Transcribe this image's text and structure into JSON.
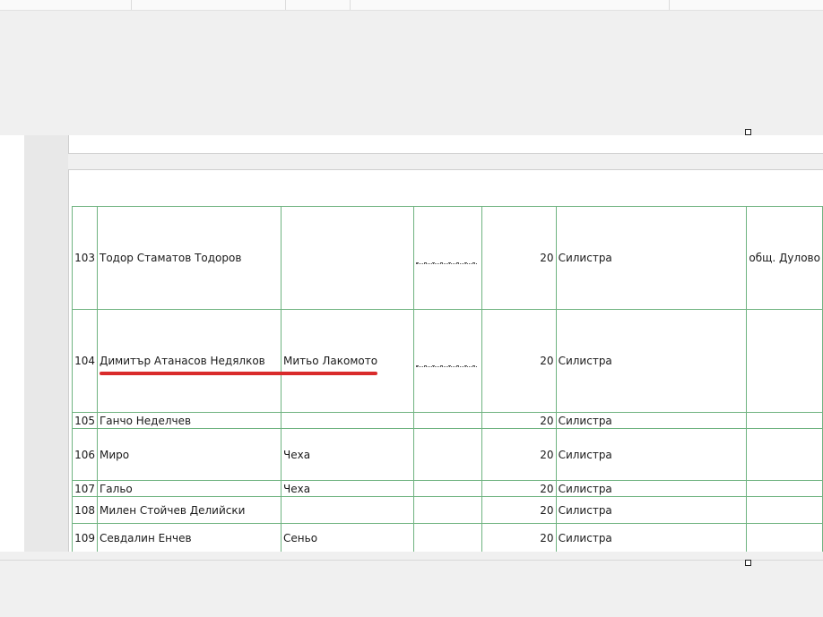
{
  "rows": [
    {
      "no": "103",
      "name": "Тодор Стаматов Тодоров",
      "alias": "",
      "id_redacted": true,
      "num": "20",
      "city": "Силистра",
      "region": "общ. Дулово"
    },
    {
      "no": "104",
      "name": "Димитър Атанасов Недялков",
      "alias": "Митьо Лакомото",
      "id_redacted": true,
      "num": "20",
      "city": "Силистра",
      "region": ""
    },
    {
      "no": "105",
      "name": "Ганчо Неделчев",
      "alias": "",
      "id_redacted": false,
      "num": "20",
      "city": "Силистра",
      "region": ""
    },
    {
      "no": "106",
      "name": "Миро",
      "alias": "Чеха",
      "id_redacted": false,
      "num": "20",
      "city": "Силистра",
      "region": ""
    },
    {
      "no": "107",
      "name": "Гальо",
      "alias": "Чеха",
      "id_redacted": false,
      "num": "20",
      "city": "Силистра",
      "region": ""
    },
    {
      "no": "108",
      "name": "Милен Стойчев Делийски",
      "alias": "",
      "id_redacted": false,
      "num": "20",
      "city": "Силистра",
      "region": ""
    },
    {
      "no": "109",
      "name": "Севдалин Енчев",
      "alias": "Сеньо",
      "id_redacted": false,
      "num": "20",
      "city": "Силистра",
      "region": ""
    }
  ],
  "colors": {
    "grid": "#6fb380",
    "annotation": "#d92b2b"
  }
}
